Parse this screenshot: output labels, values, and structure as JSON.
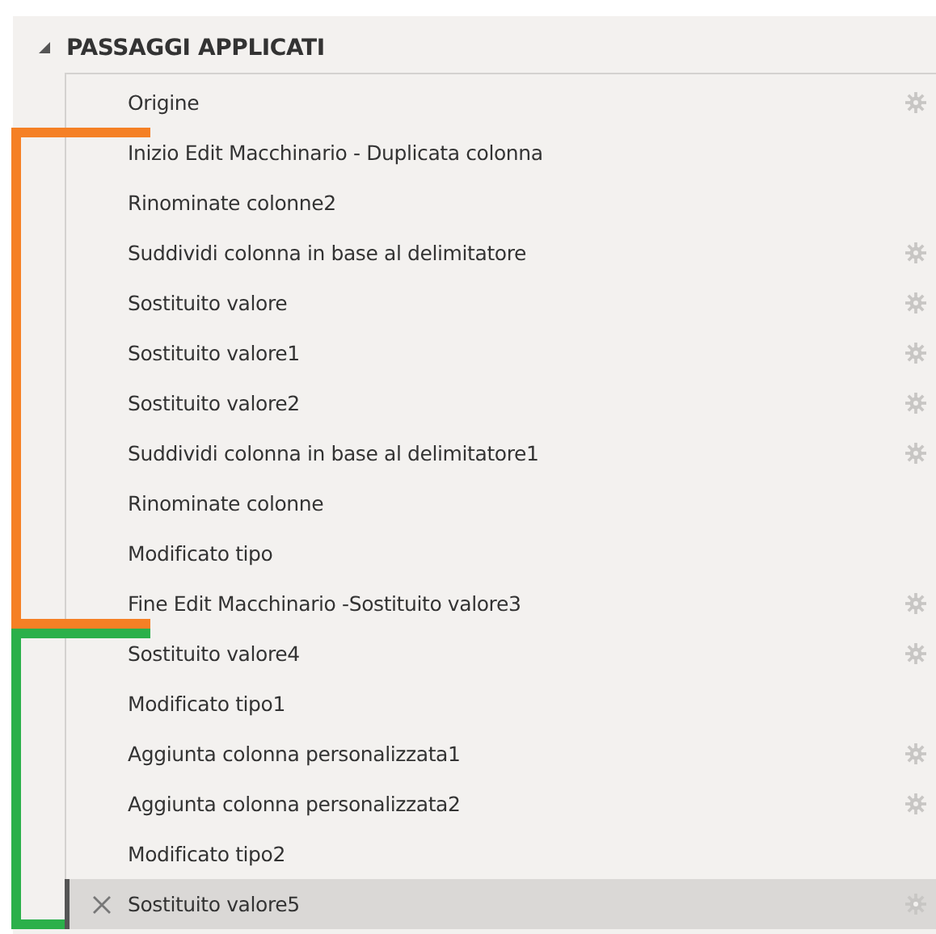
{
  "section_title": "PASSAGGI APPLICATI",
  "expanded": true,
  "groups": [
    {
      "steps": [
        {
          "label": "Origine",
          "settings": true,
          "selected": false
        }
      ]
    },
    {
      "color": "#f58025",
      "steps": [
        {
          "label": "Inizio Edit Macchinario - Duplicata colonna",
          "settings": false,
          "selected": false
        },
        {
          "label": "Rinominate colonne2",
          "settings": false,
          "selected": false
        },
        {
          "label": "Suddividi colonna in base al delimitatore",
          "settings": true,
          "selected": false
        },
        {
          "label": "Sostituito valore",
          "settings": true,
          "selected": false
        },
        {
          "label": "Sostituito valore1",
          "settings": true,
          "selected": false
        },
        {
          "label": "Sostituito valore2",
          "settings": true,
          "selected": false
        },
        {
          "label": "Suddividi colonna in base al delimitatore1",
          "settings": true,
          "selected": false
        },
        {
          "label": "Rinominate colonne",
          "settings": false,
          "selected": false
        },
        {
          "label": "Modificato tipo",
          "settings": false,
          "selected": false
        },
        {
          "label": "Fine Edit Macchinario -Sostituito valore3",
          "settings": true,
          "selected": false
        }
      ]
    },
    {
      "color": "#2bb04a",
      "steps": [
        {
          "label": "Sostituito valore4",
          "settings": true,
          "selected": false
        },
        {
          "label": "Modificato tipo1",
          "settings": false,
          "selected": false
        },
        {
          "label": "Aggiunta colonna personalizzata1",
          "settings": true,
          "selected": false
        },
        {
          "label": "Aggiunta colonna personalizzata2",
          "settings": true,
          "selected": false
        },
        {
          "label": "Modificato tipo2",
          "settings": false,
          "selected": false
        },
        {
          "label": "Sostituito valore5",
          "settings": true,
          "selected": true
        }
      ]
    }
  ]
}
